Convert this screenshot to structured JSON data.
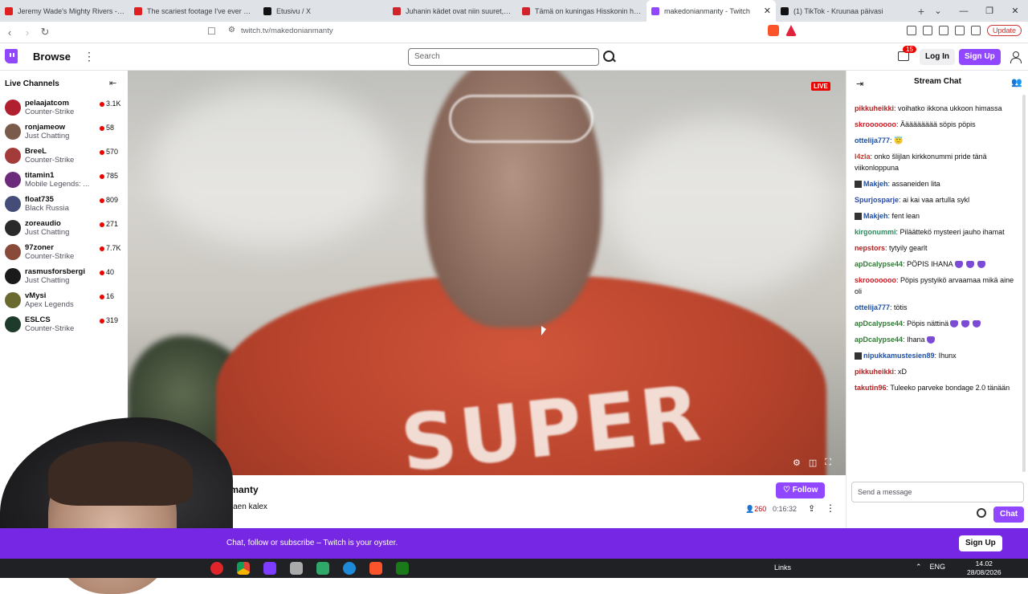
{
  "browser": {
    "tabs": [
      {
        "title": "Jeremy Wade's Mighty Rivers - Full",
        "fav_color": "#e02020"
      },
      {
        "title": "The scariest footage I've ever seen",
        "fav_color": "#e02020"
      },
      {
        "title": "Etusivu / X",
        "fav_color": "#111111"
      },
      {
        "title": "Juhanin kädet ovat niin suuret, että",
        "fav_color": "#d0232a"
      },
      {
        "title": "Tämä on kuningas Hisskonin hallitse",
        "fav_color": "#d0232a"
      },
      {
        "title": "makedonianmanty - Twitch",
        "fav_color": "#9147ff",
        "active": true
      },
      {
        "title": "(1) TikTok - Kruunaa päivasi",
        "fav_color": "#111111"
      }
    ],
    "new_tab": "+",
    "url": "twitch.tv/makedonianmanty",
    "update_label": "Update"
  },
  "nav": {
    "browse": "Browse",
    "search_placeholder": "Search",
    "notif_count": "15",
    "login": "Log In",
    "signup": "Sign Up"
  },
  "sidebar": {
    "title": "Live Channels",
    "channels": [
      {
        "name": "pelaajatcom",
        "game": "Counter-Strike",
        "viewers": "3.1K",
        "color": "#b0202f"
      },
      {
        "name": "ronjameow",
        "game": "Just Chatting",
        "viewers": "58",
        "color": "#7a5a4a"
      },
      {
        "name": "BreeL",
        "game": "Counter-Strike",
        "viewers": "570",
        "color": "#a33b3b"
      },
      {
        "name": "titamin1",
        "game": "Mobile Legends: ...",
        "viewers": "785",
        "color": "#6b2a7a"
      },
      {
        "name": "float735",
        "game": "Black Russia",
        "viewers": "809",
        "color": "#444c78"
      },
      {
        "name": "zoreaudio",
        "game": "Just Chatting",
        "viewers": "271",
        "color": "#2a2a2a"
      },
      {
        "name": "97zoner",
        "game": "Counter-Strike",
        "viewers": "7.7K",
        "color": "#8a4a3a"
      },
      {
        "name": "rasmusforsbergi",
        "game": "Just Chatting",
        "viewers": "40",
        "color": "#1a1a1a"
      },
      {
        "name": "vMysi",
        "game": "Apex Legends",
        "viewers": "16",
        "color": "#6a6a30"
      },
      {
        "name": "ESLCS",
        "game": "Counter-Strike",
        "viewers": "319",
        "color": "#1e3a2a"
      }
    ]
  },
  "player": {
    "live_label": "LIVE",
    "shirt_text": "SUPER"
  },
  "stream_info": {
    "streamer": "ianmanty",
    "title": "los haen kalex",
    "follow": "Follow",
    "viewers": "260",
    "uptime": "0:16:32"
  },
  "chat": {
    "title": "Stream Chat",
    "messages": [
      {
        "user": "pikkuheikki",
        "color": "#b22222",
        "text": "voihatko ikkona ukkoon himassa"
      },
      {
        "user": "skrooooooo",
        "color": "#d2141e",
        "text": "Äääääääää söpis pöpis"
      },
      {
        "user": "ottelija777",
        "color": "#1e4fa3",
        "text": "😇"
      },
      {
        "user": "l4zla",
        "color": "#c0392b",
        "text": "onko šlijlan kirkkonummi pride tänä viikonloppuna"
      },
      {
        "user": "Makjeh",
        "color": "#1e4fa3",
        "text": "assaneiden lita",
        "badge": true
      },
      {
        "user": "Spurjosparje",
        "color": "#2a4aa8",
        "text": "ai kai vaa artulla sykl"
      },
      {
        "user": "Makjeh",
        "color": "#1e4fa3",
        "text": "fent lean",
        "badge": true
      },
      {
        "user": "kirgonummi",
        "color": "#2b8a5c",
        "text": "Piläättekö mysteeri jauho ihamat"
      },
      {
        "user": "nepstors",
        "color": "#b22222",
        "text": "tytyily gearlt"
      },
      {
        "user": "apDcalypse44",
        "color": "#2e7d32",
        "text": "PÖPIS IHANA",
        "emotes": 3
      },
      {
        "user": "skrooooooo",
        "color": "#d2141e",
        "text": "Pöpis pystyikö arvaamaa mikä aine oli"
      },
      {
        "user": "ottelija777",
        "color": "#1e4fa3",
        "text": "tötis"
      },
      {
        "user": "apDcalypse44",
        "color": "#2e7d32",
        "text": "Pöpis nättinä",
        "emotes": 3
      },
      {
        "user": "apDcalypse44",
        "color": "#2e7d32",
        "text": "Ihana",
        "emotes": 1
      },
      {
        "user": "nipukkamustesien89",
        "color": "#1e4fa3",
        "text": "Ihunx",
        "badge": true
      },
      {
        "user": "pikkuheikki",
        "color": "#b22222",
        "text": "xD"
      },
      {
        "user": "takutin96",
        "color": "#b22222",
        "text": "Tuleeko parveke bondage 2.0 tänään"
      }
    ],
    "input_placeholder": "Send a message",
    "chat_button": "Chat"
  },
  "banner": {
    "text": "Chat, follow or subscribe – Twitch is your oyster.",
    "signup": "Sign Up"
  },
  "taskbar": {
    "links": "Links",
    "lang": "ENG",
    "time": "14.02",
    "date": "28/08/2026"
  }
}
